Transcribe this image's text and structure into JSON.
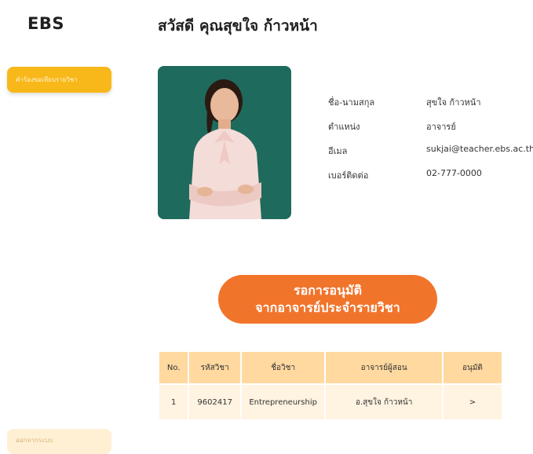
{
  "app": {
    "logo": "EBS"
  },
  "header": {
    "greeting": "สวัสดี คุณสุขใจ ก้าวหน้า"
  },
  "sidebar": {
    "items": [
      {
        "label": "คำร้องขอเทียบรายวิชา"
      }
    ],
    "logout_label": "ออกจากระบบ"
  },
  "profile": {
    "photo_icon": "teacher-photo",
    "fields": [
      {
        "label": "ชื่อ-นามสกุล",
        "value": "สุขใจ ก้าวหน้า"
      },
      {
        "label": "ตำแหน่ง",
        "value": "อาจารย์"
      },
      {
        "label": "อีเมล",
        "value": "sukjai@teacher.ebs.ac.th"
      },
      {
        "label": "เบอร์ติดต่อ",
        "value": "02-777-0000"
      }
    ]
  },
  "pending": {
    "line1": "รอการอนุมัติ",
    "line2": "จากอาจารย์ประจำรายวิชา"
  },
  "table": {
    "headers": [
      "No.",
      "รหัสวิชา",
      "ชื่อวิชา",
      "อาจารย์ผู้สอน",
      "อนุมัติ"
    ],
    "rows": [
      [
        "1",
        "9602417",
        "Entrepreneurship",
        "อ.สุขใจ ก้าวหน้า",
        ">"
      ]
    ]
  },
  "colors": {
    "primary": "#f8b81a",
    "accent": "#f1742b",
    "table_header": "#ffd9a0",
    "table_row": "#fff3e1",
    "photo_bg": "#1e6a5d"
  }
}
